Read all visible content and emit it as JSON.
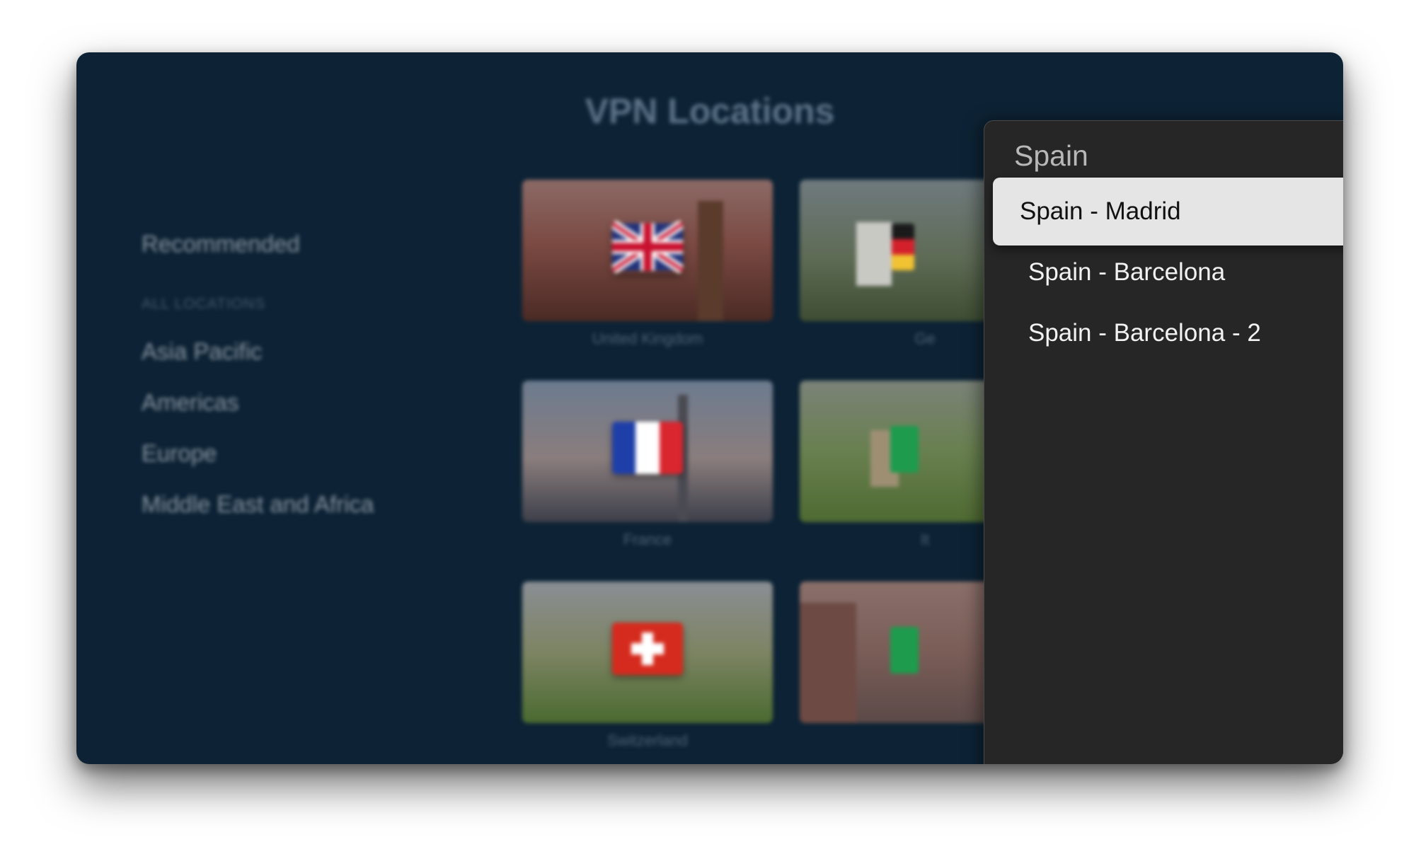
{
  "app": {
    "title": "VPN Locations"
  },
  "sidebar": {
    "recommended_label": "Recommended",
    "section_label": "ALL LOCATIONS",
    "regions": [
      {
        "label": "Asia Pacific"
      },
      {
        "label": "Americas"
      },
      {
        "label": "Europe"
      },
      {
        "label": "Middle East and Africa"
      }
    ]
  },
  "grid": {
    "tiles": [
      {
        "country": "United Kingdom",
        "flag": "uk-flag-icon"
      },
      {
        "country": "Ge",
        "flag": "germany-flag-icon"
      },
      {
        "country": "France",
        "flag": "france-flag-icon"
      },
      {
        "country": "It",
        "flag": "italy-flag-icon"
      },
      {
        "country": "Switzerland",
        "flag": "switzerland-flag-icon"
      },
      {
        "country": "",
        "flag": "green-flag-icon"
      }
    ]
  },
  "location_picker": {
    "title": "Spain",
    "options": [
      {
        "label": "Spain - Madrid",
        "selected": true
      },
      {
        "label": "Spain - Barcelona",
        "selected": false
      },
      {
        "label": "Spain - Barcelona - 2",
        "selected": false
      }
    ]
  },
  "colors": {
    "background": "#0d2335",
    "modal_background": "#262626",
    "selected_option": "#e5e5e5"
  }
}
